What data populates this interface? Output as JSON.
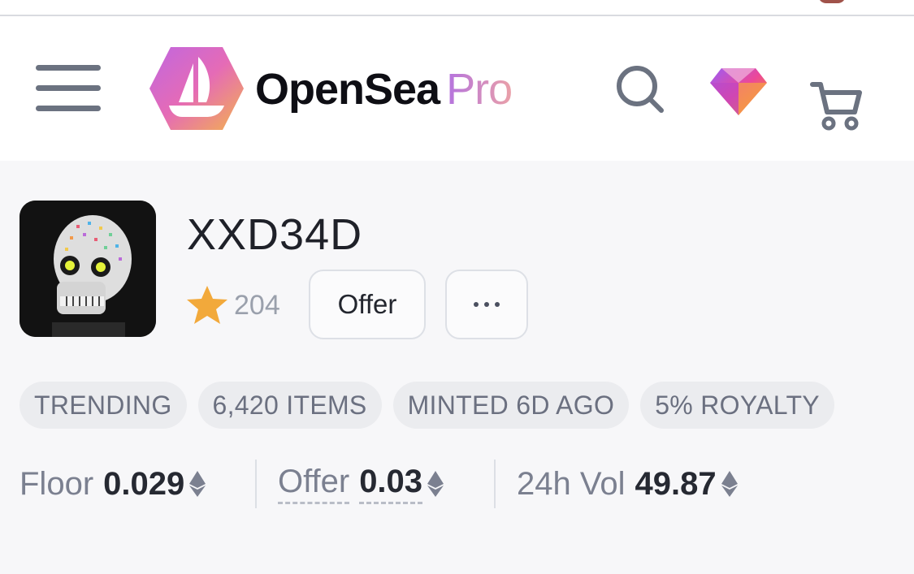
{
  "header": {
    "brand_name": "OpenSea",
    "brand_suffix": "Pro",
    "icons": [
      "menu-icon",
      "opensea-logo",
      "search-icon",
      "gem-icon",
      "cart-icon"
    ]
  },
  "collection": {
    "name": "XXD34D",
    "favorites_count": "204",
    "offer_button": "Offer",
    "tags": [
      "TRENDING",
      "6,420 ITEMS",
      "MINTED 6D AGO",
      "5% ROYALTY"
    ],
    "stats": {
      "floor_label": "Floor",
      "floor_value": "0.029",
      "offer_label": "Offer",
      "offer_value": "0.03",
      "volume_label": "24h Vol",
      "volume_value": "49.87"
    }
  },
  "colors": {
    "brand_gradient_start": "#b473df",
    "brand_gradient_end": "#eaa0a8",
    "star": "#f2a93b",
    "background": "#f7f7f9"
  }
}
